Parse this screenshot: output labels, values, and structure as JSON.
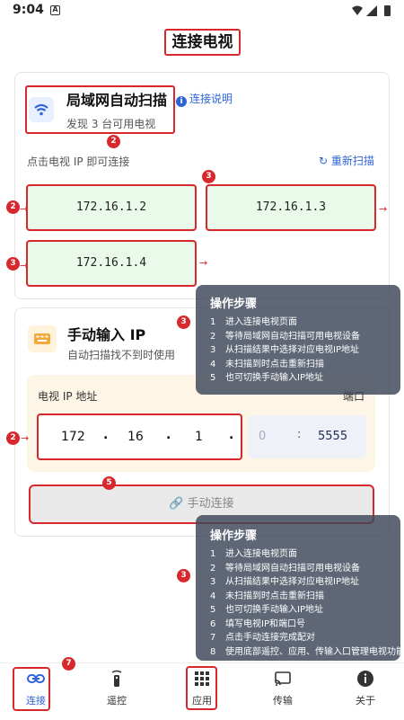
{
  "status_bar": {
    "time": "9:04",
    "notification_icon": "A"
  },
  "page_title": "连接电视",
  "scan": {
    "title": "局域网自动扫描",
    "subtitle": "发现 3 台可用电视",
    "help_link": "连接说明",
    "hint": "点击电视 IP 即可连接",
    "rescan": "重新扫描",
    "devices": [
      "172.16.1.2",
      "172.16.1.3",
      "172.16.1.4"
    ]
  },
  "manual": {
    "title": "手动输入 IP",
    "subtitle": "自动扫描找不到时使用",
    "ip_label": "电视 IP 地址",
    "port_label": "端口",
    "ip_octets": [
      "172",
      "16",
      "1",
      ""
    ],
    "ip_separator": ".",
    "port_placeholder": "0",
    "port_separator": ":",
    "port": "5555",
    "connect_button": "手动连接"
  },
  "badges": {
    "two": "2",
    "three": "3",
    "five": "5",
    "seven": "7"
  },
  "steps_short": {
    "title": "操作步骤",
    "items": [
      "进入连接电视页面",
      "等待局域网自动扫描可用电视设备",
      "从扫描结果中选择对应电视IP地址",
      "未扫描到时点击重新扫描",
      "也可切换手动输入IP地址"
    ]
  },
  "steps_full": {
    "title": "操作步骤",
    "items": [
      "进入连接电视页面",
      "等待局域网自动扫描可用电视设备",
      "从扫描结果中选择对应电视IP地址",
      "未扫描到时点击重新扫描",
      "也可切换手动输入IP地址",
      "填写电视IP和端口号",
      "点击手动连接完成配对",
      "使用底部遥控、应用、传输入口管理电视功能"
    ]
  },
  "nav": [
    {
      "label": "连接",
      "icon": "link-icon"
    },
    {
      "label": "遥控",
      "icon": "remote-icon"
    },
    {
      "label": "应用",
      "icon": "apps-grid-icon"
    },
    {
      "label": "传输",
      "icon": "cast-icon"
    },
    {
      "label": "关于",
      "icon": "info-icon"
    }
  ],
  "colors": {
    "accent": "#2f63d6",
    "annotation": "#d7282e",
    "tile": "#eafaea"
  }
}
